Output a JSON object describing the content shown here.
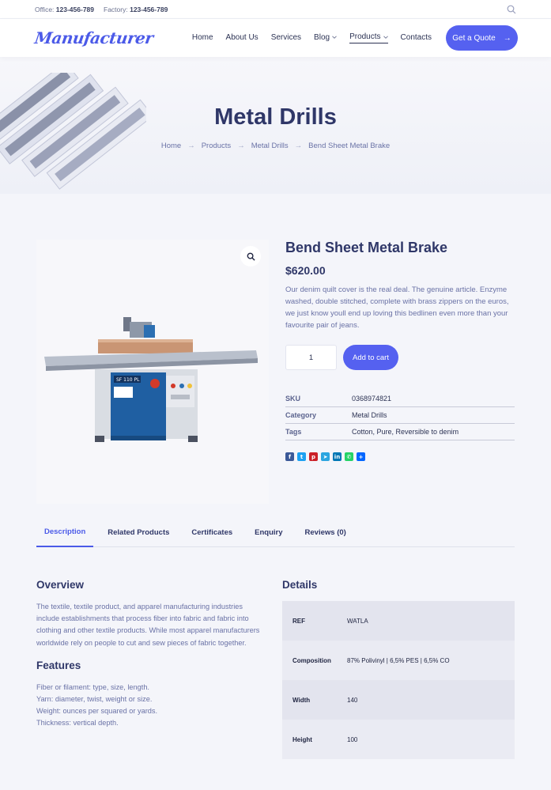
{
  "topbar": {
    "office_label": "Office:",
    "office_phone": "123-456-789",
    "factory_label": "Factory:",
    "factory_phone": "123-456-789"
  },
  "header": {
    "logo_text": "Manufacturer",
    "nav": [
      "Home",
      "About Us",
      "Services",
      "Blog",
      "Products",
      "Contacts"
    ],
    "active_nav": "Products",
    "quote_button": "Get a Quote"
  },
  "hero": {
    "title": "Metal Drills",
    "breadcrumb": [
      "Home",
      "Products",
      "Metal Drills",
      "Bend Sheet Metal Brake"
    ]
  },
  "product": {
    "name": "Bend Sheet Metal Brake",
    "price": "$620.00",
    "description": "Our denim quilt cover is the real deal. The genuine article. Enzyme washed, double stitched, complete with brass zippers on the euros, we just know youll end up loving this bedlinen even more than your favourite pair of jeans.",
    "quantity": "1",
    "add_to_cart": "Add to cart",
    "meta": [
      {
        "label": "SKU",
        "value": "0368974821"
      },
      {
        "label": "Category",
        "value": "Metal Drills"
      },
      {
        "label": "Tags",
        "value": "Cotton, Pure, Reversible to denim"
      }
    ],
    "share_icons": [
      "facebook-icon",
      "twitter-icon",
      "pinterest-icon",
      "telegram-icon",
      "linkedin-icon",
      "whatsapp-icon",
      "share-plus-icon"
    ],
    "machine_label": "SF 110 PL"
  },
  "tabs": [
    "Description",
    "Related Products",
    "Certificates",
    "Enquiry",
    "Reviews (0)"
  ],
  "overview": {
    "title": "Overview",
    "text": "The textile, textile product, and apparel manufacturing industries include establishments that process fiber into fabric and fabric into clothing and other textile products. While most apparel manufacturers worldwide rely on people to cut and sew pieces of fabric together.",
    "features_title": "Features",
    "features": [
      "Fiber or filament: type, size, length.",
      "Yarn: diameter, twist, weight or size.",
      "Weight: ounces per squared or yards.",
      "Thickness: vertical depth."
    ]
  },
  "details": {
    "title": "Details",
    "rows": [
      {
        "k": "REF",
        "v": "WATLA"
      },
      {
        "k": "Composition",
        "v": "87% Polivinyl | 6,5% PES | 6,5% CO"
      },
      {
        "k": "Width",
        "v": "140"
      },
      {
        "k": "Height",
        "v": "100"
      }
    ]
  },
  "colors": {
    "accent": "#5561f0",
    "heading": "#2f3768",
    "body_text": "#6a72a6"
  }
}
